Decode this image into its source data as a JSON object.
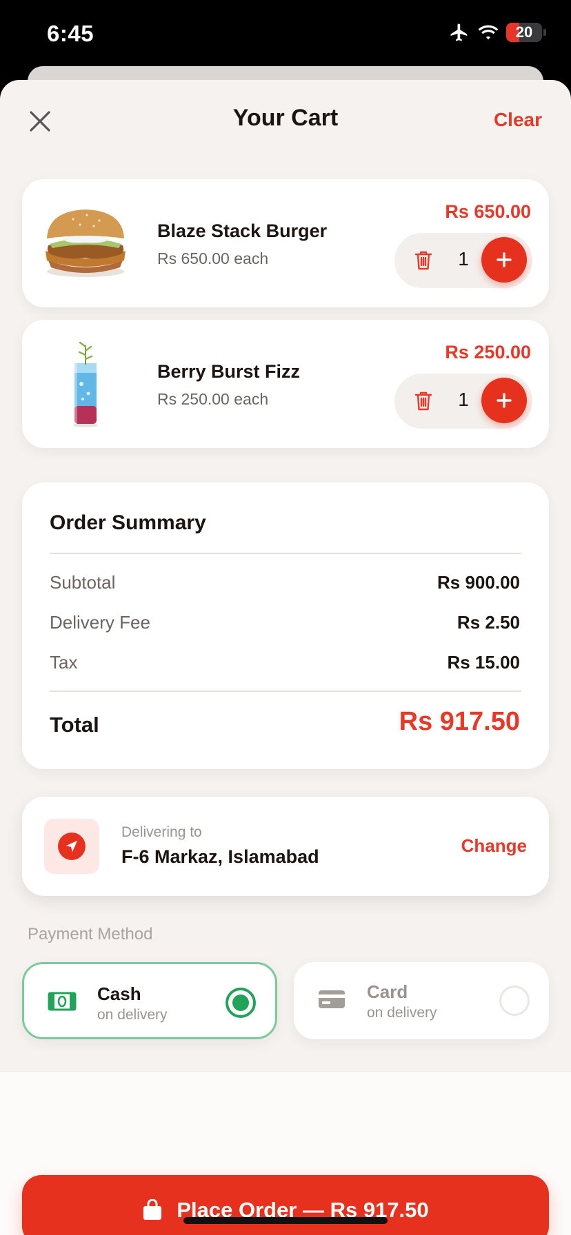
{
  "status_bar": {
    "time": "6:45",
    "battery": "20"
  },
  "header": {
    "title": "Your Cart",
    "clear_label": "Clear"
  },
  "cart_items": [
    {
      "name": "Blaze Stack Burger",
      "each": "Rs 650.00 each",
      "total": "Rs 650.00",
      "qty": "1",
      "image": "burger-image"
    },
    {
      "name": "Berry Burst Fizz",
      "each": "Rs 250.00 each",
      "total": "Rs 250.00",
      "qty": "1",
      "image": "drink-image"
    }
  ],
  "summary": {
    "title": "Order Summary",
    "subtotal_label": "Subtotal",
    "subtotal_value": "Rs 900.00",
    "delivery_label": "Delivery Fee",
    "delivery_value": "Rs 2.50",
    "tax_label": "Tax",
    "tax_value": "Rs 15.00",
    "total_label": "Total",
    "total_value": "Rs 917.50"
  },
  "delivery": {
    "label": "Delivering to",
    "address": "F-6 Markaz, Islamabad",
    "change_label": "Change",
    "icon": "navigation-arrow-icon"
  },
  "payment": {
    "section_label": "Payment Method",
    "options": [
      {
        "name": "Cash",
        "sub": "on delivery",
        "selected": true,
        "icon": "cash-icon"
      },
      {
        "name": "Card",
        "sub": "on delivery",
        "selected": false,
        "icon": "credit-card-icon"
      }
    ]
  },
  "place_order": {
    "label": "Place Order — Rs 917.50",
    "icon": "shopping-bag-icon"
  },
  "colors": {
    "accent": "#e5311e",
    "success": "#22a35a",
    "background": "#f5f2ef"
  }
}
